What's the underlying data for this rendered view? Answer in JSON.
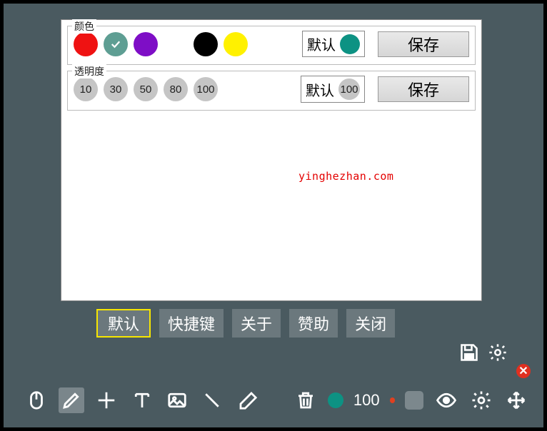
{
  "colorSection": {
    "legend": "颜色",
    "swatches": [
      {
        "name": "red",
        "color": "#ef1212",
        "selected": false
      },
      {
        "name": "teal",
        "color": "#5e9e93",
        "selected": true
      },
      {
        "name": "purple",
        "color": "#7e0ec6",
        "selected": false
      },
      {
        "name": "white",
        "color": "#ffffff",
        "selected": false
      },
      {
        "name": "black",
        "color": "#000000",
        "selected": false
      },
      {
        "name": "yellow",
        "color": "#fff100",
        "selected": false
      }
    ],
    "default": {
      "label": "默认",
      "color": "#0d9283"
    },
    "saveLabel": "保存"
  },
  "opacitySection": {
    "legend": "透明度",
    "values": [
      "10",
      "30",
      "50",
      "80",
      "100"
    ],
    "default": {
      "label": "默认",
      "value": "100"
    },
    "saveLabel": "保存"
  },
  "watermark": "yinghezhan.com",
  "tabs": [
    {
      "label": "默认",
      "active": true
    },
    {
      "label": "快捷键",
      "active": false
    },
    {
      "label": "关于",
      "active": false
    },
    {
      "label": "赞助",
      "active": false
    },
    {
      "label": "关闭",
      "active": false
    }
  ],
  "toolbar": {
    "opacityValue": "100"
  }
}
